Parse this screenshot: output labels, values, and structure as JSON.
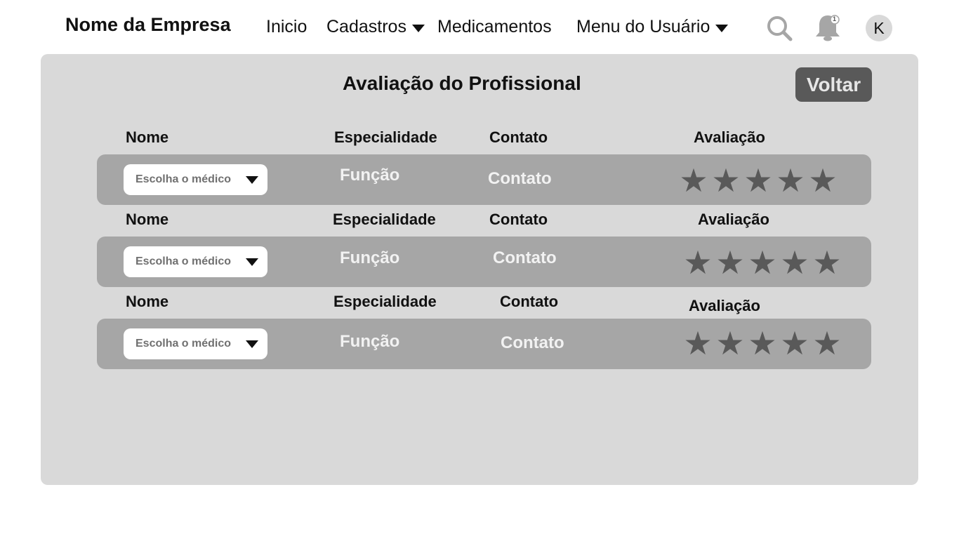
{
  "navbar": {
    "brand": "Nome da Empresa",
    "items": [
      {
        "label": "Inicio"
      },
      {
        "label": "Cadastros"
      },
      {
        "label": "Medicamentos"
      },
      {
        "label": "Menu do Usuário"
      }
    ],
    "notification_count": "1",
    "avatar_initial": "K"
  },
  "page": {
    "title": "Avaliação do Profissional",
    "back_label": "Voltar"
  },
  "columns": {
    "nome": "Nome",
    "especialidade": "Especialidade",
    "contato": "Contato",
    "avaliacao": "Avaliação"
  },
  "rows": [
    {
      "select_value": "Escolha o médico",
      "funcao": "Função",
      "contato": "Contato",
      "rating": 5,
      "star": "★"
    },
    {
      "select_value": "Escolha o médico",
      "funcao": "Função",
      "contato": "Contato",
      "rating": 5,
      "star": "★"
    },
    {
      "select_value": "Escolha o médico",
      "funcao": "Função",
      "contato": "Contato",
      "rating": 5,
      "star": "★"
    }
  ],
  "colors": {
    "panel": "#d9d9d9",
    "row": "#a6a6a6",
    "button": "#595959",
    "star": "#595959",
    "icon": "#a6a6a6"
  }
}
